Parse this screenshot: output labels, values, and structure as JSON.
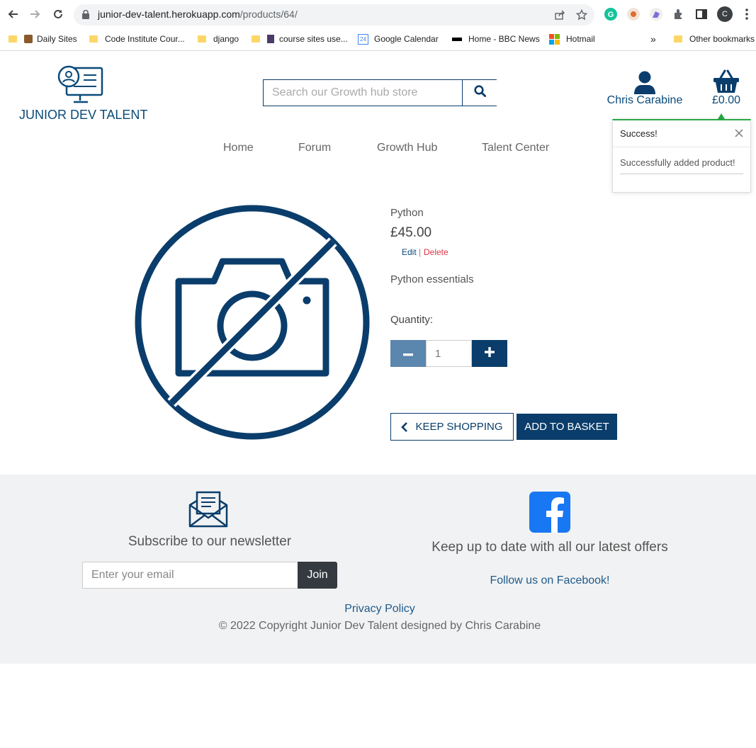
{
  "browser": {
    "url_host": "junior-dev-talent.herokuapp.com",
    "url_path": "/products/64/",
    "profile_initial": "C",
    "bookmarks": [
      {
        "label": "Daily Sites"
      },
      {
        "label": "Code Institute Cour..."
      },
      {
        "label": "django"
      },
      {
        "label": "course sites use..."
      },
      {
        "label": "Google Calendar"
      },
      {
        "label": "Home - BBC News"
      },
      {
        "label": "Hotmail"
      }
    ],
    "other_bookmarks": "Other bookmarks",
    "overflow": "»"
  },
  "header": {
    "brand": "JUNIOR DEV TALENT",
    "search_placeholder": "Search our Growth hub store",
    "account_name": "Chris Carabine",
    "basket_total": "£0.00"
  },
  "nav": {
    "items": [
      "Home",
      "Forum",
      "Growth Hub",
      "Talent Center"
    ]
  },
  "toast": {
    "title": "Success!",
    "message": "Successfully added product!"
  },
  "product": {
    "name": "Python",
    "price": "£45.00",
    "edit_label": "Edit",
    "separator": "|",
    "delete_label": "Delete",
    "description": "Python essentials",
    "quantity_label": "Quantity:",
    "quantity_value": "1",
    "keep_shopping_label": "KEEP SHOPPING",
    "add_to_basket_label": "ADD TO BASKET"
  },
  "footer": {
    "newsletter_title": "Subscribe to our newsletter",
    "email_placeholder": "Enter your email",
    "join_label": "Join",
    "offers_text": "Keep up to date with all our latest offers",
    "facebook_link": "Follow us on Facebook!",
    "privacy_link": "Privacy Policy",
    "copyright": "© 2022 Copyright Junior Dev Talent designed by Chris Carabine"
  },
  "colors": {
    "brand_navy": "#0a3d6b",
    "minus_button": "#5b86ad",
    "facebook_blue": "#1877f2",
    "delete_red": "#dc3545",
    "success_green": "#28a745"
  },
  "icons": {
    "logo": "developer-monitor-icon",
    "search": "magnifier-icon",
    "account": "user-icon",
    "basket": "basket-icon",
    "product_image": "no-image-camera-icon",
    "newsletter": "envelope-letter-icon",
    "facebook": "facebook-icon"
  }
}
